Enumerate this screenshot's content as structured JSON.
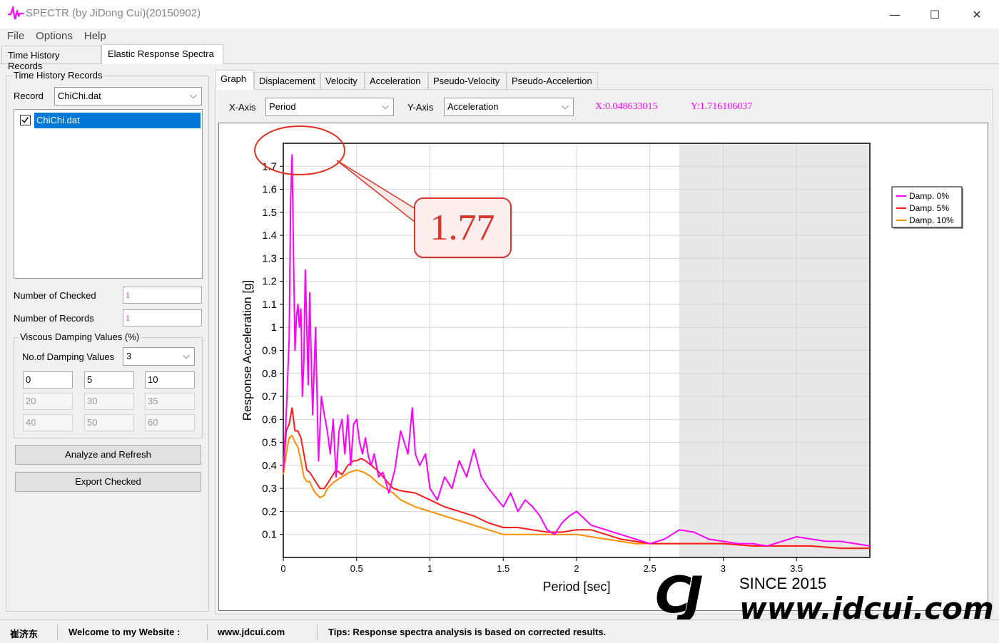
{
  "window": {
    "title": "SPECTR (by JiDong Cui)(20150902)",
    "minimize": "—",
    "maximize": "☐",
    "close": "✕"
  },
  "menu": [
    "File",
    "Options",
    "Help"
  ],
  "top_tabs": [
    "Time History Records",
    "Elastic Response Spectra"
  ],
  "left": {
    "group_title": "Time History Records",
    "record_label": "Record",
    "record_value": "ChiChi.dat",
    "list_items": [
      {
        "label": "ChiChi.dat",
        "checked": true
      }
    ],
    "num_checked_label": "Number of Checked",
    "num_checked_value": "1",
    "num_records_label": "Number of Records",
    "num_records_value": "1",
    "damping_group_title": "Viscous Damping Values (%)",
    "no_damping_label": "No.of Damping Values",
    "no_damping_value": "3",
    "damping_values": [
      "0",
      "5",
      "10",
      "20",
      "30",
      "35",
      "40",
      "50",
      "60"
    ],
    "analyze_button": "Analyze and Refresh",
    "export_button": "Export Checked"
  },
  "sub_tabs": [
    "Graph",
    "Displacement",
    "Velocity",
    "Acceleration",
    "Pseudo-Velocity",
    "Pseudo-Accelertion"
  ],
  "axis_select": {
    "x_label": "X-Axis",
    "x_value": "Period",
    "y_label": "Y-Axis",
    "y_value": "Acceleration",
    "x_readout": "X:0.048633015",
    "y_readout": "Y:1.716106037"
  },
  "annotation": {
    "text": "1.77"
  },
  "watermark": {
    "since": "SINCE 2015",
    "url": "www.jdcui.com",
    "logo": "CJ"
  },
  "status": {
    "author": "崔济东",
    "welcome": "Welcome to my Website :",
    "site": "www.jdcui.com",
    "tips": "Tips: Response spectra analysis is based on corrected results."
  },
  "colors": {
    "magenta": "#ff00ff",
    "red": "#ff1a1a",
    "orange": "#ff8c00",
    "selection": "#0078d7",
    "annotation": "#d9352b"
  },
  "chart_data": {
    "type": "line",
    "xlabel": "Period [sec]",
    "ylabel": "Response Acceleration [g]",
    "xlim": [
      0,
      4
    ],
    "ylim": [
      0,
      1.8
    ],
    "x_ticks": [
      0,
      0.5,
      1,
      1.5,
      2,
      2.5,
      3,
      3.5
    ],
    "x_tick_labels": [
      "0",
      "0.5",
      "1",
      "1.5",
      "2",
      "2.5",
      "3",
      "3.5"
    ],
    "y_ticks": [
      0.1,
      0.2,
      0.3,
      0.4,
      0.5,
      0.6,
      0.7,
      0.8,
      0.9,
      1,
      1.1,
      1.2,
      1.3,
      1.4,
      1.5,
      1.6,
      1.7
    ],
    "y_tick_labels": [
      "0.1",
      "0.2",
      "0.3",
      "0.4",
      "0.5",
      "0.6",
      "0.7",
      "0.8",
      "0.9",
      "1",
      "1.1",
      "1.2",
      "1.3",
      "1.4",
      "1.5",
      "1.6",
      "1.7"
    ],
    "grid": true,
    "legend_position": "right",
    "series": [
      {
        "name": "Damp. 0%",
        "color": "#ff00ff",
        "x": [
          0,
          0.02,
          0.04,
          0.05,
          0.06,
          0.07,
          0.08,
          0.09,
          0.1,
          0.11,
          0.12,
          0.13,
          0.14,
          0.15,
          0.16,
          0.17,
          0.18,
          0.2,
          0.22,
          0.24,
          0.26,
          0.28,
          0.3,
          0.32,
          0.34,
          0.36,
          0.38,
          0.4,
          0.42,
          0.44,
          0.46,
          0.48,
          0.5,
          0.52,
          0.54,
          0.56,
          0.58,
          0.6,
          0.62,
          0.65,
          0.68,
          0.72,
          0.76,
          0.8,
          0.85,
          0.88,
          0.9,
          0.93,
          0.97,
          1.0,
          1.05,
          1.1,
          1.15,
          1.2,
          1.25,
          1.3,
          1.35,
          1.4,
          1.5,
          1.55,
          1.6,
          1.65,
          1.7,
          1.75,
          1.8,
          1.85,
          1.9,
          1.95,
          2.0,
          2.05,
          2.1,
          2.2,
          2.3,
          2.4,
          2.5,
          2.6,
          2.7,
          2.8,
          2.9,
          3.0,
          3.1,
          3.2,
          3.3,
          3.4,
          3.5,
          3.6,
          3.7,
          3.8,
          3.9,
          4.0
        ],
        "y": [
          0.38,
          0.62,
          0.95,
          1.55,
          1.75,
          1.3,
          0.9,
          1.05,
          1.1,
          1.0,
          1.08,
          0.7,
          0.85,
          1.25,
          1.0,
          0.75,
          1.15,
          0.62,
          1.0,
          0.42,
          0.7,
          0.62,
          0.55,
          0.45,
          0.6,
          0.35,
          0.55,
          0.6,
          0.45,
          0.62,
          0.4,
          0.58,
          0.6,
          0.5,
          0.45,
          0.52,
          0.44,
          0.4,
          0.45,
          0.35,
          0.37,
          0.28,
          0.38,
          0.55,
          0.45,
          0.65,
          0.45,
          0.4,
          0.45,
          0.3,
          0.25,
          0.35,
          0.3,
          0.42,
          0.35,
          0.47,
          0.35,
          0.3,
          0.22,
          0.28,
          0.2,
          0.25,
          0.22,
          0.18,
          0.12,
          0.1,
          0.15,
          0.18,
          0.2,
          0.17,
          0.14,
          0.12,
          0.1,
          0.08,
          0.06,
          0.08,
          0.12,
          0.11,
          0.08,
          0.07,
          0.06,
          0.06,
          0.05,
          0.07,
          0.09,
          0.08,
          0.07,
          0.07,
          0.06,
          0.05
        ]
      },
      {
        "name": "Damp. 5%",
        "color": "#ff1a1a",
        "x": [
          0,
          0.02,
          0.04,
          0.06,
          0.08,
          0.1,
          0.12,
          0.14,
          0.16,
          0.18,
          0.2,
          0.22,
          0.25,
          0.28,
          0.3,
          0.33,
          0.36,
          0.4,
          0.44,
          0.48,
          0.5,
          0.53,
          0.56,
          0.6,
          0.64,
          0.68,
          0.72,
          0.75,
          0.8,
          0.9,
          1.0,
          1.1,
          1.2,
          1.3,
          1.4,
          1.5,
          1.6,
          1.7,
          1.8,
          1.9,
          2.0,
          2.1,
          2.2,
          2.3,
          2.4,
          2.5,
          2.6,
          2.7,
          2.8,
          3.0,
          3.2,
          3.4,
          3.6,
          3.8,
          4.0
        ],
        "y": [
          0.37,
          0.55,
          0.58,
          0.65,
          0.55,
          0.55,
          0.52,
          0.45,
          0.38,
          0.37,
          0.35,
          0.33,
          0.3,
          0.3,
          0.32,
          0.35,
          0.38,
          0.36,
          0.4,
          0.42,
          0.42,
          0.43,
          0.42,
          0.4,
          0.38,
          0.35,
          0.32,
          0.3,
          0.29,
          0.28,
          0.25,
          0.22,
          0.2,
          0.18,
          0.15,
          0.13,
          0.13,
          0.12,
          0.11,
          0.11,
          0.12,
          0.12,
          0.1,
          0.08,
          0.07,
          0.06,
          0.06,
          0.06,
          0.06,
          0.06,
          0.05,
          0.05,
          0.05,
          0.04,
          0.04
        ]
      },
      {
        "name": "Damp. 10%",
        "color": "#ff8c00",
        "x": [
          0,
          0.02,
          0.04,
          0.06,
          0.08,
          0.1,
          0.12,
          0.14,
          0.16,
          0.18,
          0.2,
          0.22,
          0.25,
          0.28,
          0.3,
          0.35,
          0.4,
          0.45,
          0.5,
          0.55,
          0.6,
          0.65,
          0.7,
          0.75,
          0.8,
          0.9,
          1.0,
          1.1,
          1.2,
          1.3,
          1.4,
          1.5,
          1.6,
          1.7,
          1.8,
          1.9,
          2.0,
          2.1,
          2.2,
          2.3,
          2.4,
          2.5,
          2.6,
          2.8,
          3.0,
          3.2,
          3.4,
          3.6,
          3.8,
          4.0
        ],
        "y": [
          0.36,
          0.45,
          0.52,
          0.53,
          0.5,
          0.48,
          0.42,
          0.35,
          0.33,
          0.33,
          0.3,
          0.28,
          0.26,
          0.27,
          0.3,
          0.33,
          0.35,
          0.37,
          0.38,
          0.37,
          0.35,
          0.32,
          0.3,
          0.28,
          0.25,
          0.22,
          0.2,
          0.18,
          0.16,
          0.14,
          0.12,
          0.1,
          0.1,
          0.1,
          0.1,
          0.1,
          0.1,
          0.09,
          0.08,
          0.07,
          0.06,
          0.06,
          0.06,
          0.06,
          0.06,
          0.05,
          0.05,
          0.05,
          0.04,
          0.04
        ]
      }
    ]
  }
}
